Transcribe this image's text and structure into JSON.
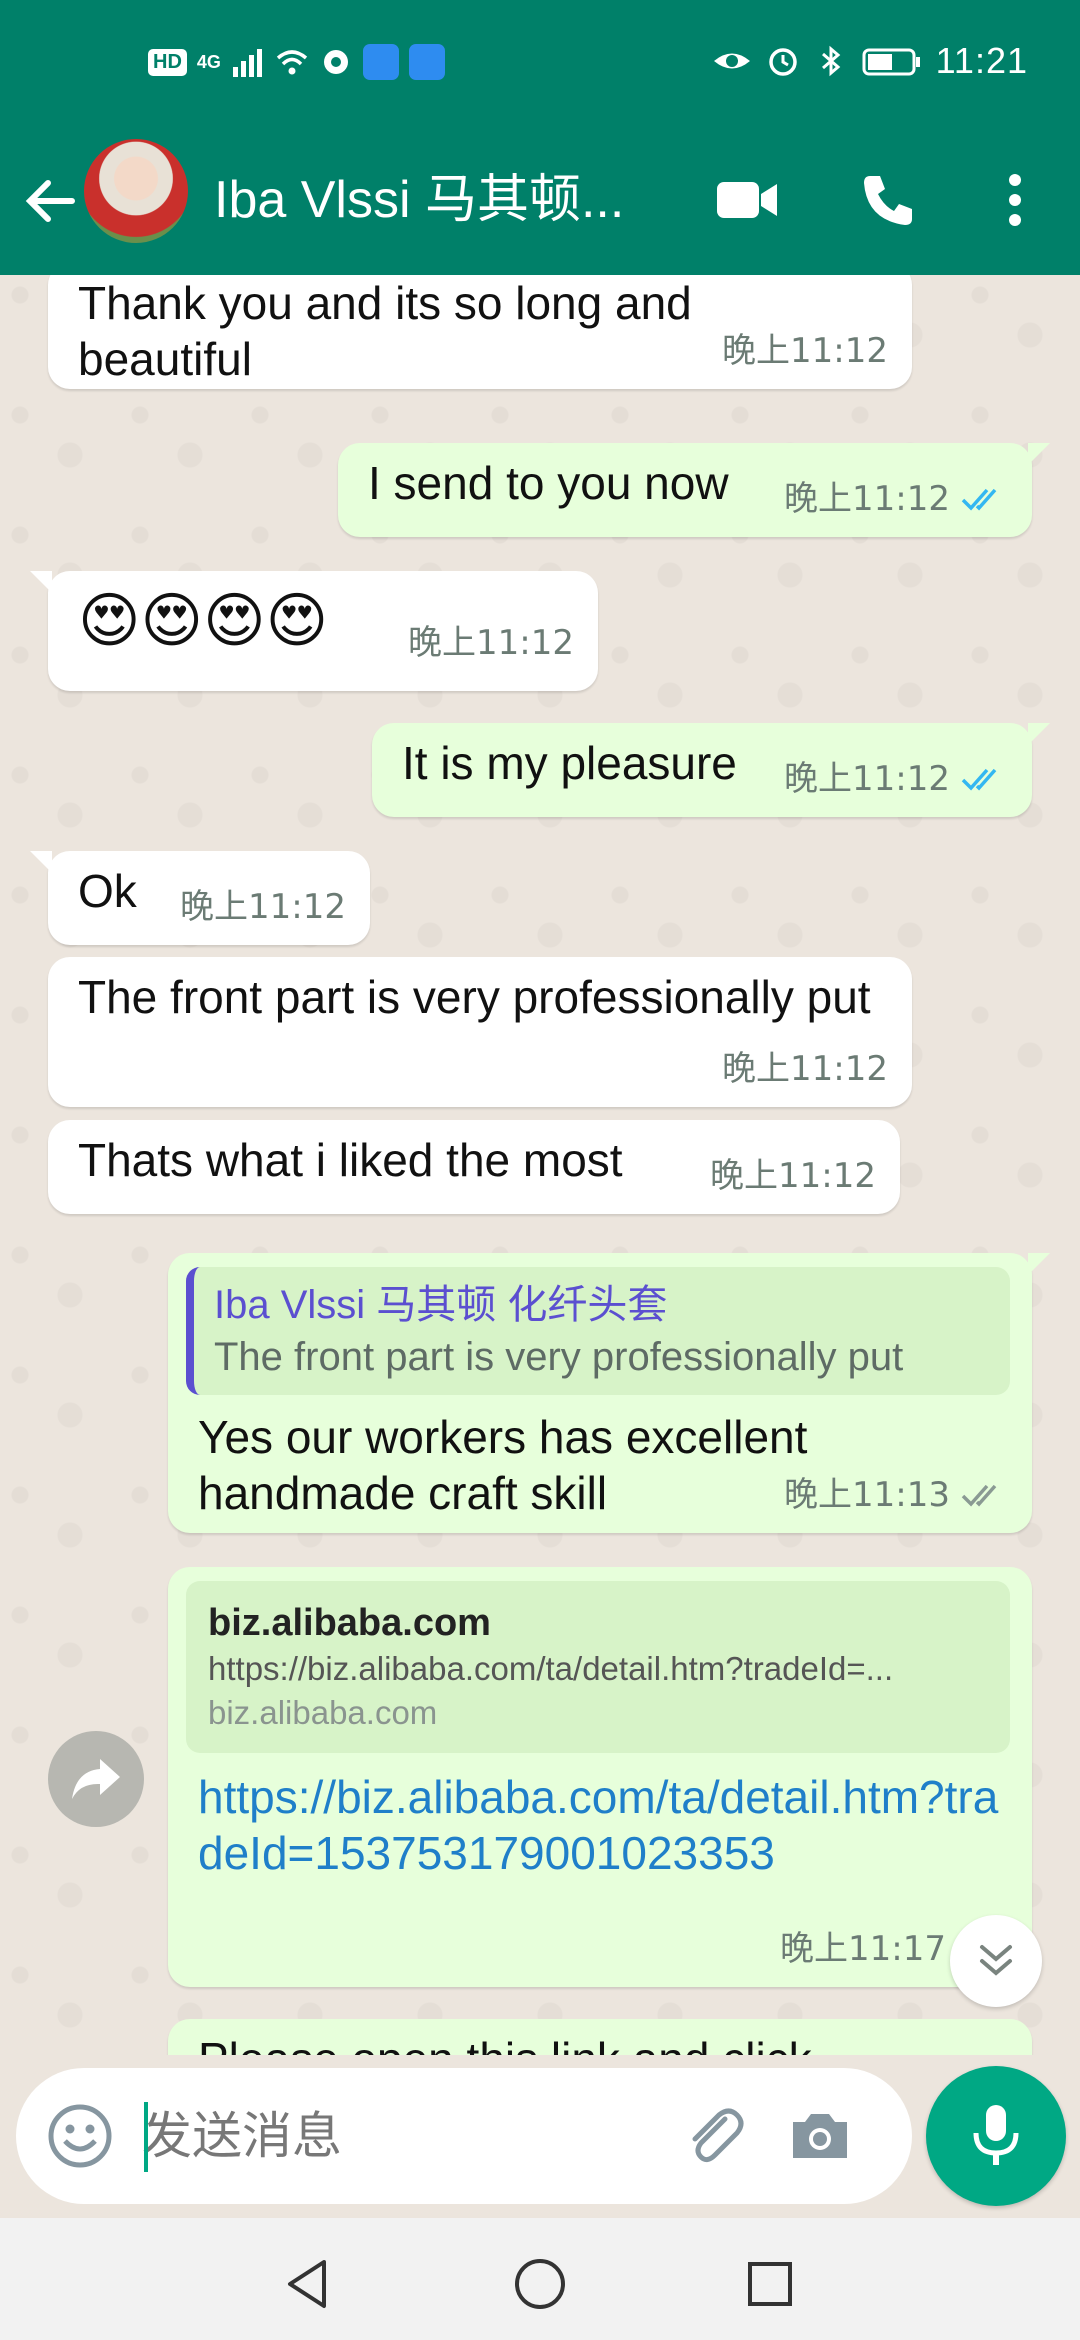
{
  "status_bar": {
    "hd": "HD",
    "network": "4G",
    "time": "11:21"
  },
  "header": {
    "contact_name": "Iba Vlssi 马其顿..."
  },
  "messages": [
    {
      "text": "Thank you and its so long and beautiful",
      "time": "晚上11:12",
      "direction": "in"
    },
    {
      "text": "I send to you now",
      "time": "晚上11:12",
      "direction": "out",
      "read": true
    },
    {
      "text": "😍😍😍😍",
      "time": "晚上11:12",
      "direction": "in"
    },
    {
      "text": "It is my pleasure",
      "time": "晚上11:12",
      "direction": "out",
      "read": true
    },
    {
      "text": "Ok",
      "time": "晚上11:12",
      "direction": "in"
    },
    {
      "text": "The front part is very professionally put",
      "time": "晚上11:12",
      "direction": "in"
    },
    {
      "text": "Thats what i liked the most",
      "time": "晚上11:12",
      "direction": "in"
    },
    {
      "quote_name": "Iba Vlssi 马其顿 化纤头套",
      "quote_text": "The front part is very professionally put",
      "text": "Yes our workers has excellent handmade craft skill",
      "time": "晚上11:13",
      "direction": "out",
      "read": false
    },
    {
      "preview_title": "biz.alibaba.com",
      "preview_desc": "https://biz.alibaba.com/ta/detail.htm?tradeId=...",
      "preview_host": "biz.alibaba.com",
      "text": "https://biz.alibaba.com/ta/detail.htm?tradeId=153753179001023353",
      "time": "晚上11:17",
      "direction": "out"
    },
    {
      "text": "Please open this link and click",
      "direction": "out"
    }
  ],
  "input": {
    "placeholder": "发送消息"
  },
  "colors": {
    "brand": "#008069",
    "accent": "#00a884",
    "outgoing_bubble": "#e7ffdb",
    "incoming_bubble": "#ffffff",
    "read_ticks": "#34b7f1",
    "link": "#1f7fc9",
    "quote_name": "#5b4fd0"
  },
  "icons": {
    "back": "arrow-left-icon",
    "video": "video-camera-icon",
    "call": "phone-icon",
    "menu": "more-vertical-icon",
    "forward": "forward-arrow-icon",
    "scroll_down": "double-chevron-down-icon",
    "emoji": "emoji-icon",
    "attach": "paperclip-icon",
    "camera": "camera-icon",
    "mic": "microphone-icon",
    "nav_back": "triangle-back-icon",
    "nav_home": "circle-home-icon",
    "nav_recent": "square-recent-icon"
  }
}
